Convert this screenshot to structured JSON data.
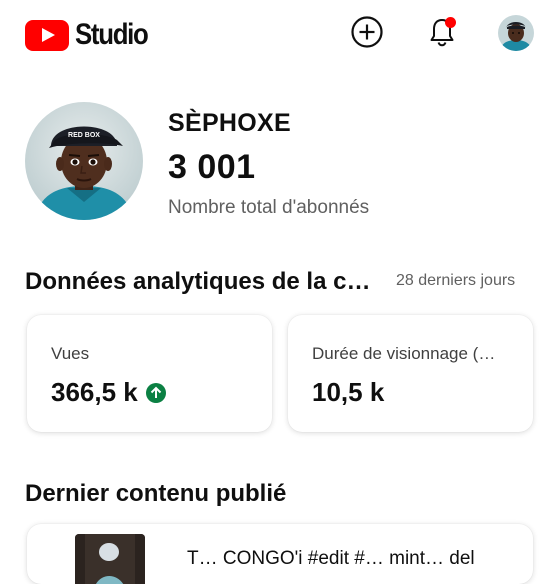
{
  "header": {
    "logo_text": "Studio",
    "create_icon": "plus-circle-icon",
    "notifications_icon": "bell-icon",
    "notification_dot_color": "#ff0000",
    "brand_color": "#ff0000"
  },
  "channel": {
    "name": "SÈPHOXE",
    "subscriber_count": "3 001",
    "subscriber_label": "Nombre total d'abonnés",
    "avatar_cap_text": "RED BOX"
  },
  "analytics": {
    "title": "Données analytiques de la c…",
    "period": "28 derniers jours",
    "cards": [
      {
        "label": "Vues",
        "value": "366,5 k",
        "trend_icon": "arrow-up-circle-icon",
        "trend_color": "#0b8043"
      },
      {
        "label": "Durée de visionnage (…",
        "value": "10,5 k"
      }
    ]
  },
  "latest": {
    "title": "Dernier contenu publié",
    "video_title": "T… CONGO'i #edit #… mint… del"
  }
}
